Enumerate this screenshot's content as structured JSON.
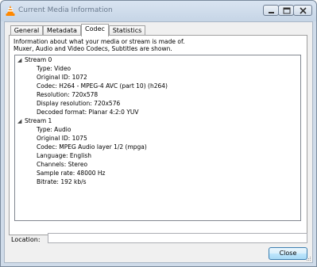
{
  "window": {
    "title": "Current Media Information"
  },
  "tabs": [
    {
      "label": "General",
      "active": false
    },
    {
      "label": "Metadata",
      "active": false
    },
    {
      "label": "Codec",
      "active": true
    },
    {
      "label": "Statistics",
      "active": false
    }
  ],
  "codec_panel": {
    "description_line1": "Information about what your media or stream is made of.",
    "description_line2": "Muxer, Audio and Video Codecs, Subtitles are shown.",
    "streams": [
      {
        "label": "Stream 0",
        "expanded": true,
        "items": [
          "Type: Video",
          "Original ID: 1072",
          "Codec: H264 - MPEG-4 AVC (part 10) (h264)",
          "Resolution: 720x578",
          "Display resolution: 720x576",
          "Decoded format: Planar 4:2:0 YUV"
        ]
      },
      {
        "label": "Stream 1",
        "expanded": true,
        "items": [
          "Type: Audio",
          "Original ID: 1075",
          "Codec: MPEG Audio layer 1/2 (mpga)",
          "Language: English",
          "Channels: Stereo",
          "Sample rate: 48000 Hz",
          "Bitrate: 192 kb/s"
        ]
      }
    ]
  },
  "location": {
    "label": "Location:",
    "value": ""
  },
  "buttons": {
    "close_label": "Close"
  },
  "colors": {
    "window_frame": "#cfdbe9",
    "client_bg": "#f0f0f0",
    "close_button_border": "#3c7fb1",
    "vlc_cone": "#ff8800"
  },
  "icons": {
    "app": "vlc-cone-icon",
    "minimize": "minimize-icon",
    "maximize": "maximize-icon",
    "close": "close-icon",
    "expand": "expanded-arrow-icon"
  }
}
